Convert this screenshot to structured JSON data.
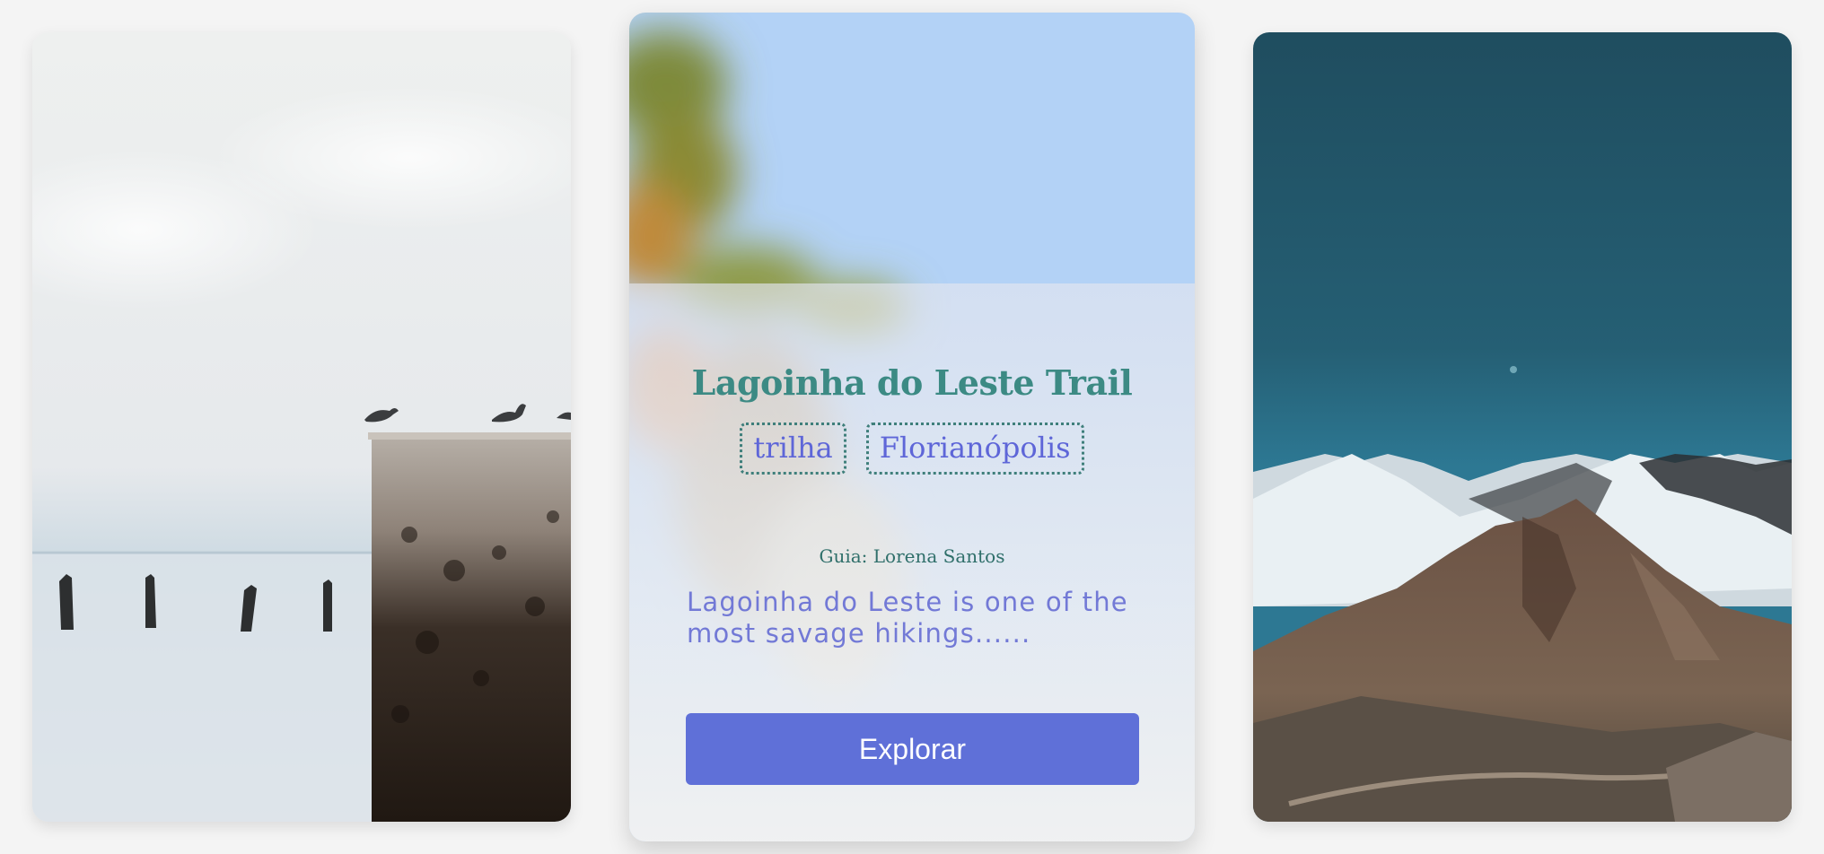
{
  "cards": {
    "left": {
      "image": "seagulls-on-pier-photo"
    },
    "center": {
      "image": "blurred-tree-sky-photo",
      "title": "Lagoinha do Leste Trail",
      "tags": [
        "trilha",
        "Florianópolis"
      ],
      "guide": "Guia: Lorena Santos",
      "description": "Lagoinha do Leste is one of the most savage hikings......",
      "button_label": "Explorar"
    },
    "right": {
      "image": "snowy-mountains-photo"
    }
  },
  "colors": {
    "page_background": "#f4f4f4",
    "title": "#3c8a84",
    "tag_text": "#5e66d8",
    "tag_border": "#3f7f7b",
    "description": "#7279d6",
    "button": "#5f70d8",
    "button_text": "#ffffff"
  }
}
